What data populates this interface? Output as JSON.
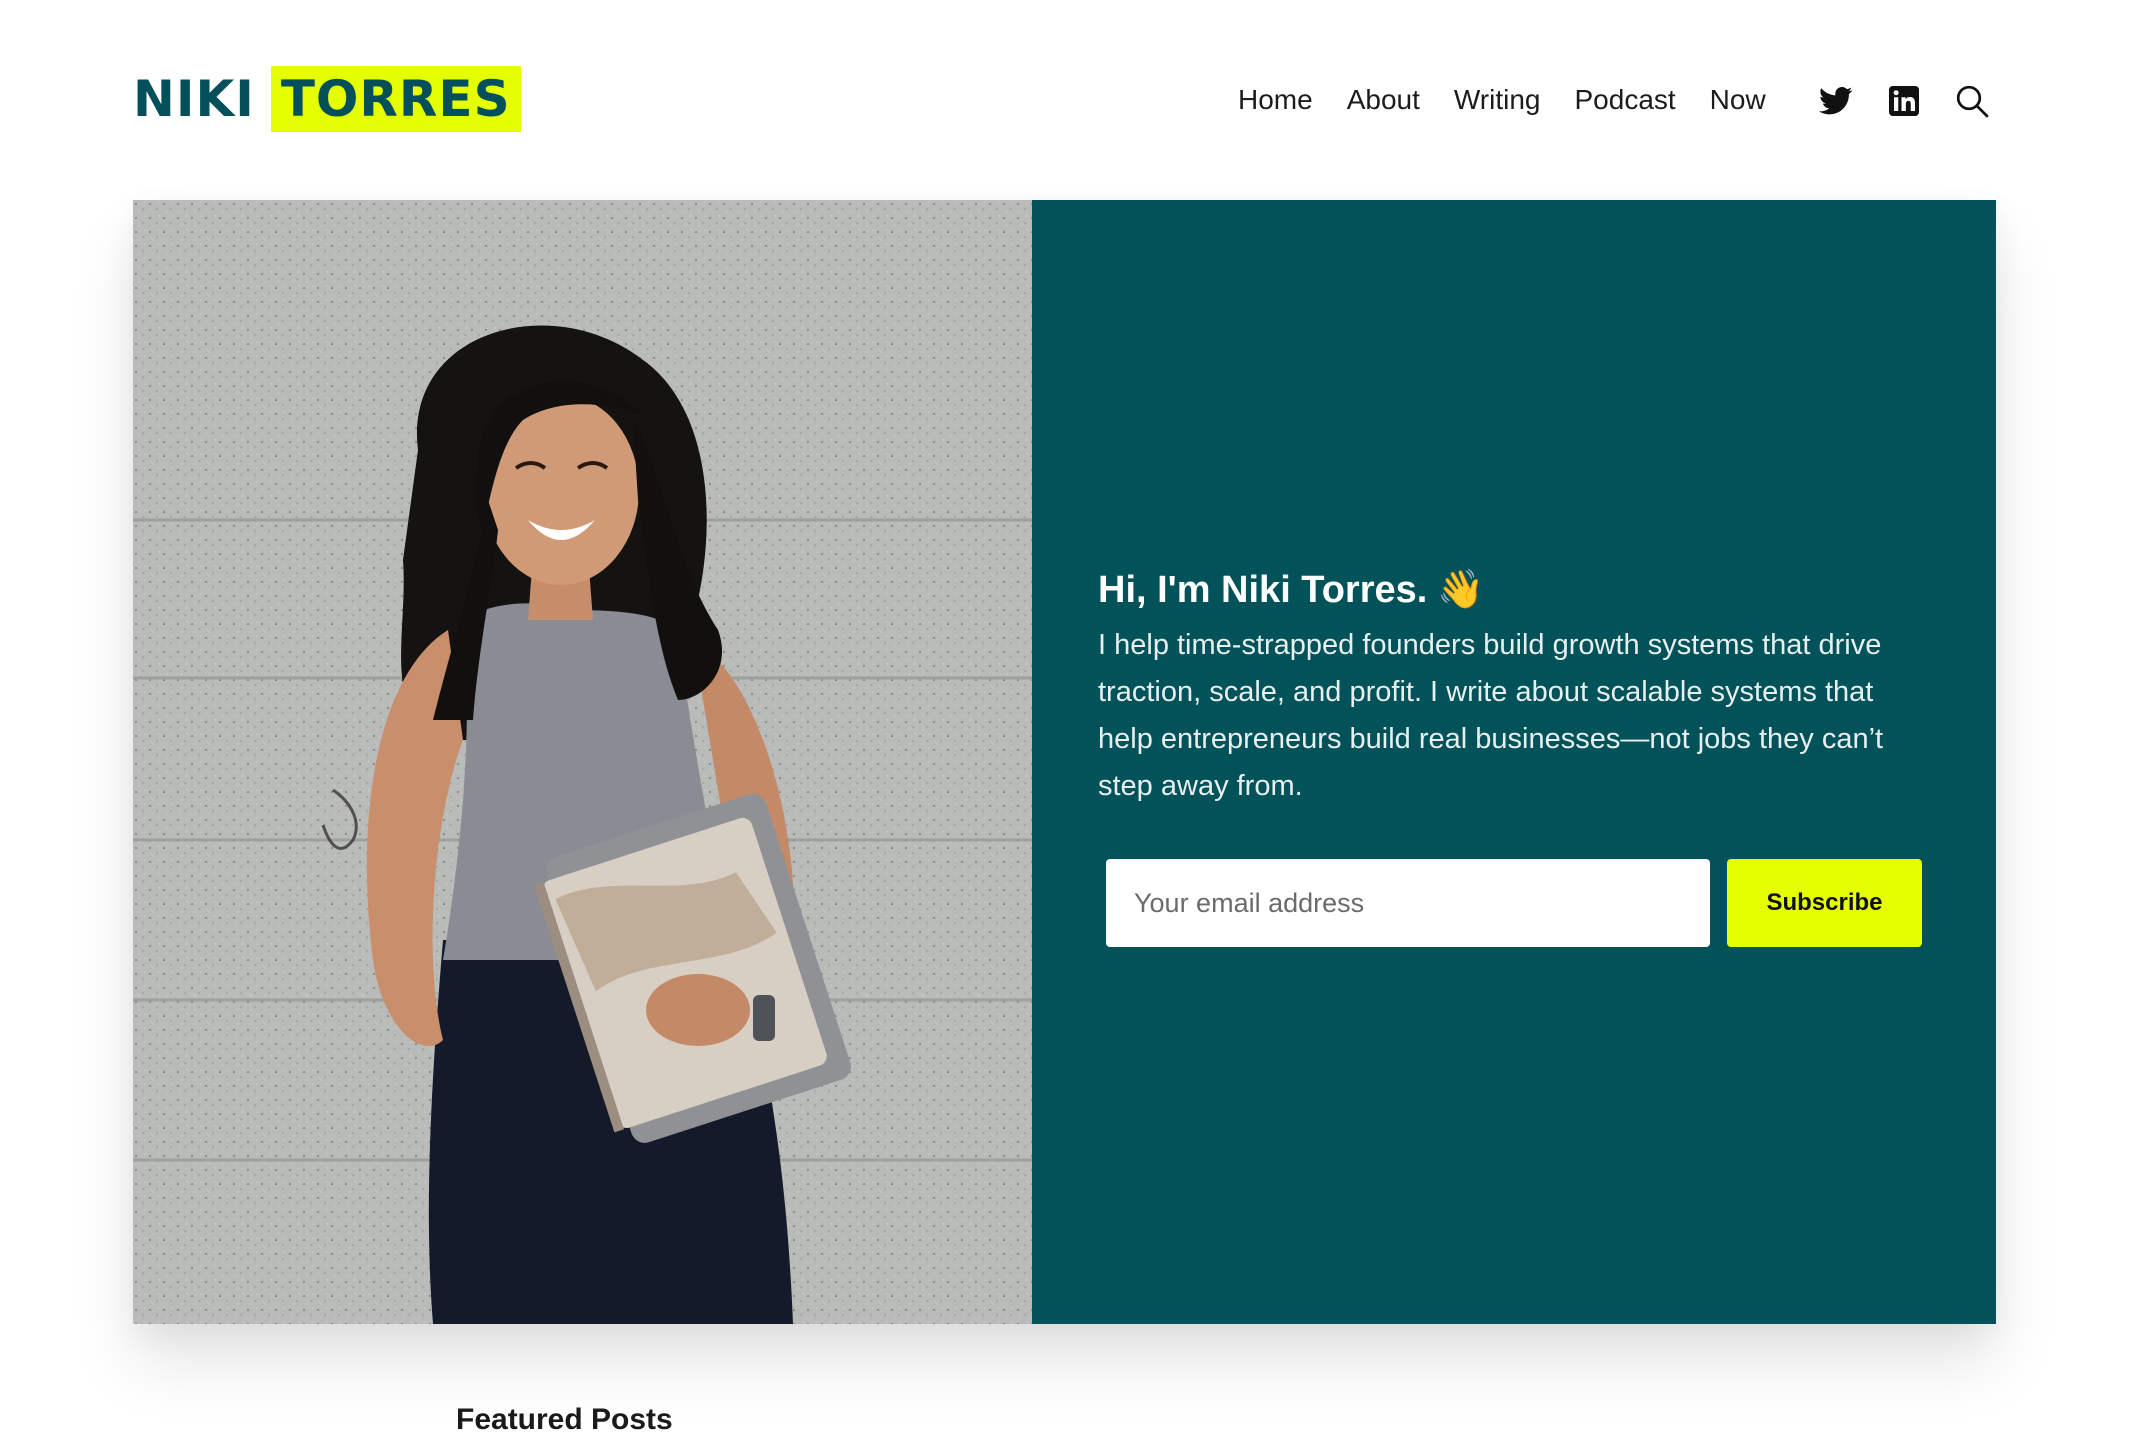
{
  "brand": {
    "first_name": "NIKI",
    "last_name": "TORRES",
    "accent_color": "#e6ff00",
    "primary_color": "#04505a"
  },
  "nav": {
    "items": [
      {
        "label": "Home"
      },
      {
        "label": "About"
      },
      {
        "label": "Writing"
      },
      {
        "label": "Podcast"
      },
      {
        "label": "Now"
      }
    ],
    "icons": [
      "twitter-icon",
      "linkedin-icon",
      "search-icon"
    ]
  },
  "hero": {
    "panel_color": "#02525a",
    "title": "Hi, I'm Niki Torres.",
    "wave_emoji": "👋",
    "body": "I help time-strapped founders build growth systems that drive traction, scale, and profit. I write about scalable systems that help entrepreneurs build real businesses—not jobs they can’t step away from.",
    "email_placeholder": "Your email address",
    "subscribe_label": "Subscribe"
  },
  "featured": {
    "heading": "Featured Posts"
  }
}
